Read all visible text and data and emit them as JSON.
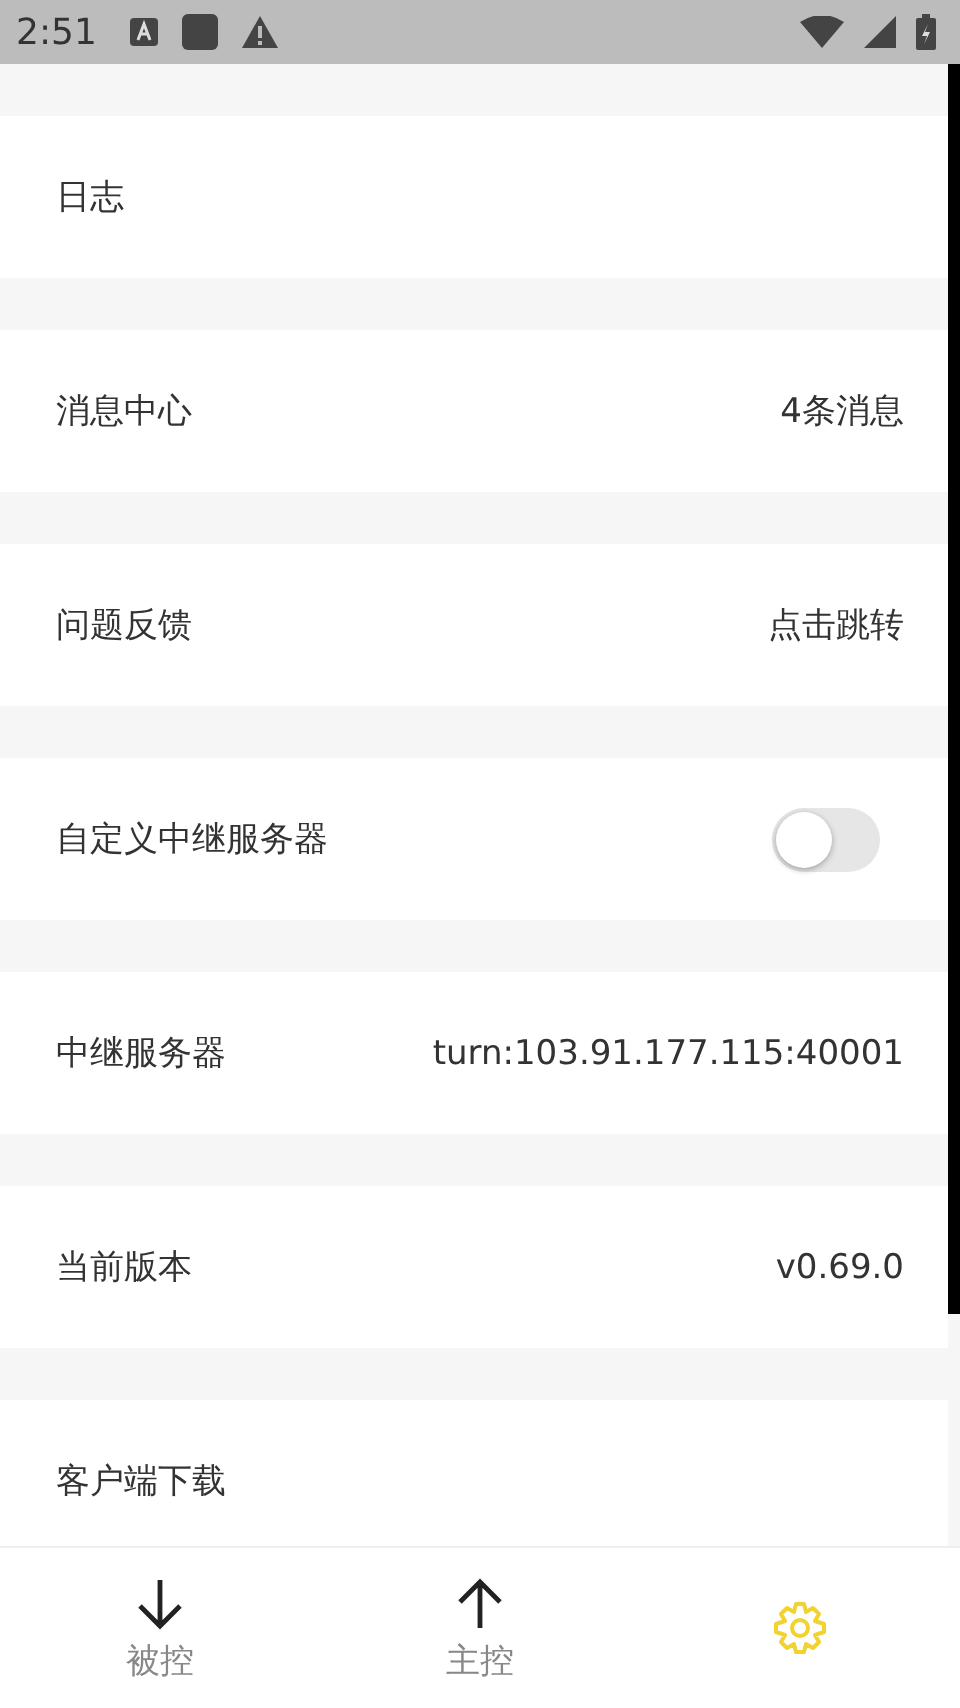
{
  "status_bar": {
    "time": "2:51"
  },
  "settings": [
    {
      "kind": "plain",
      "label": "日志"
    },
    {
      "kind": "value",
      "label": "消息中心",
      "value": "4条消息"
    },
    {
      "kind": "value",
      "label": "问题反馈",
      "value": "点击跳转"
    },
    {
      "kind": "toggle",
      "label": "自定义中继服务器",
      "on": false
    },
    {
      "kind": "value",
      "label": "中继服务器",
      "value": "turn:103.91.177.115:40001"
    },
    {
      "kind": "value",
      "label": "当前版本",
      "value": "v0.69.0"
    },
    {
      "kind": "plain",
      "label": "客户端下载"
    }
  ],
  "bottom_nav": [
    {
      "label": "被控",
      "selected": false
    },
    {
      "label": "主控",
      "selected": false
    },
    {
      "selected": true
    }
  ]
}
